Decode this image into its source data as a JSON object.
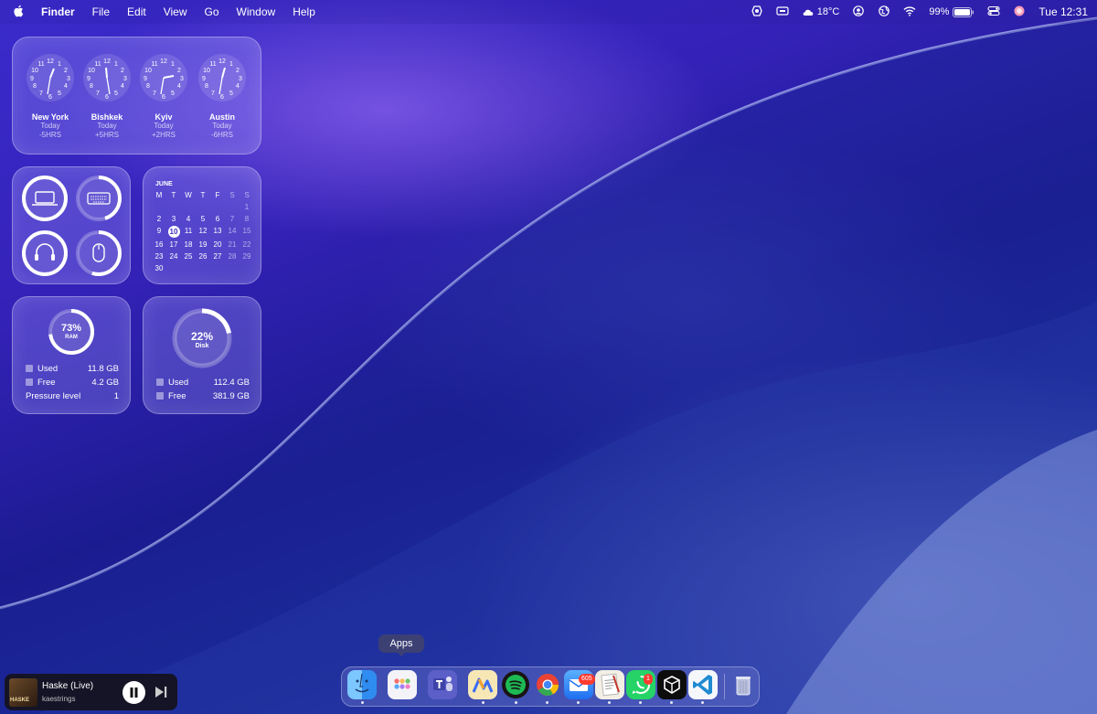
{
  "menubar": {
    "apple_icon": "apple-icon",
    "app_name": "Finder",
    "menus": [
      "File",
      "Edit",
      "View",
      "Go",
      "Window",
      "Help"
    ],
    "weather": "18°C",
    "battery": "99%",
    "datetime": "Tue 12:31"
  },
  "world_clock": {
    "clocks": [
      {
        "city": "New York",
        "day": "Today",
        "offset": "-5HRS"
      },
      {
        "city": "Bishkek",
        "day": "Today",
        "offset": "+5HRS"
      },
      {
        "city": "Kyiv",
        "day": "Today",
        "offset": "+2HRS"
      },
      {
        "city": "Austin",
        "day": "Today",
        "offset": "-6HRS"
      }
    ]
  },
  "batteries": {
    "devices": [
      {
        "icon": "laptop-icon",
        "level": 1.0
      },
      {
        "icon": "keyboard-icon",
        "level": 0.45
      },
      {
        "icon": "headphones-icon",
        "level": 1.0
      },
      {
        "icon": "mouse-icon",
        "level": 0.55
      }
    ]
  },
  "calendar": {
    "month": "JUNE",
    "weekdays": [
      "M",
      "T",
      "W",
      "T",
      "F",
      "S",
      "S"
    ],
    "weeks": [
      [
        "",
        "",
        "",
        "",
        "",
        "",
        "1"
      ],
      [
        "2",
        "3",
        "4",
        "5",
        "6",
        "7",
        "8"
      ],
      [
        "9",
        "10",
        "11",
        "12",
        "13",
        "14",
        "15"
      ],
      [
        "16",
        "17",
        "18",
        "19",
        "20",
        "21",
        "22"
      ],
      [
        "23",
        "24",
        "25",
        "26",
        "27",
        "28",
        "29"
      ],
      [
        "30",
        "",
        "",
        "",
        "",
        "",
        ""
      ]
    ],
    "today": "10"
  },
  "memory": {
    "percent": "73%",
    "label": "RAM",
    "fraction": 0.73,
    "used_label": "Used",
    "used_value": "11.8 GB",
    "free_label": "Free",
    "free_value": "4.2 GB",
    "pressure_label": "Pressure level",
    "pressure_value": "1"
  },
  "disk": {
    "percent": "22%",
    "label": "Disk",
    "fraction": 0.22,
    "used_label": "Used",
    "used_value": "112.4 GB",
    "free_label": "Free",
    "free_value": "381.9 GB"
  },
  "dock": {
    "tooltip": "Apps",
    "apps": [
      {
        "name": "finder-icon",
        "color": "#2f8cf0",
        "running": true
      },
      {
        "name": "apps-icon",
        "color": "#f2f2f7",
        "running": false
      },
      {
        "name": "teams-icon",
        "color": "#5b5fc7",
        "running": false
      },
      {
        "name": "analytics-icon",
        "color": "#f5d36a",
        "running": true
      },
      {
        "name": "spotify-icon",
        "color": "#1db954",
        "running": true
      },
      {
        "name": "chrome-icon",
        "color": "#f1f1f1",
        "running": true
      },
      {
        "name": "mail-icon",
        "color": "#2f7cf6",
        "running": true
      },
      {
        "name": "textedit-icon",
        "color": "#f4f0e8",
        "running": true
      },
      {
        "name": "whatsapp-icon",
        "color": "#25d366",
        "running": true
      },
      {
        "name": "cube-icon",
        "color": "#1a1a1a",
        "running": true
      },
      {
        "name": "vscode-icon",
        "color": "#f5f7fb",
        "running": true
      },
      {
        "name": "trash-icon",
        "color": "#c5c9d6",
        "running": false
      }
    ],
    "mail_badge": "605",
    "whatsapp_badge": "1"
  },
  "now_playing": {
    "title": "Haske (Live)",
    "artist": "kaestrings",
    "art_text": "HASKE"
  }
}
